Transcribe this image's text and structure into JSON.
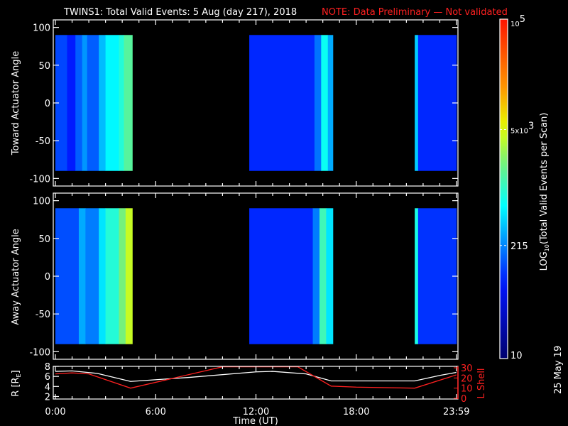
{
  "title": "TWINS1: Total Valid Events:  5 Aug (day 217), 2018",
  "note": "NOTE: Data Preliminary — Not validated",
  "stamp": "25 May 19",
  "colors": {
    "note": "#ff2020",
    "lshell": "#ff2020",
    "rline": "#ffffff",
    "bg": "#000000"
  },
  "chart_data": [
    {
      "type": "heatmap",
      "name": "toward",
      "ylabel": "Toward Actuator Angle",
      "ylim": [
        -110,
        110
      ],
      "yticks": [
        "100",
        "50",
        "0",
        "-50",
        "-100"
      ],
      "ytick_values": [
        100,
        50,
        0,
        -50,
        -100
      ],
      "data_angle_range": [
        -90,
        90
      ],
      "xlim_hours": [
        0,
        24
      ],
      "columns": [
        {
          "start": 0,
          "end": 0.7,
          "counts": 120
        },
        {
          "start": 0.7,
          "end": 1.2,
          "counts": 80
        },
        {
          "start": 1.2,
          "end": 1.6,
          "counts": 150
        },
        {
          "start": 1.6,
          "end": 1.9,
          "counts": 250
        },
        {
          "start": 1.9,
          "end": 2.6,
          "counts": 150
        },
        {
          "start": 2.6,
          "end": 3.0,
          "counts": 350
        },
        {
          "start": 3.0,
          "end": 3.8,
          "counts": 600
        },
        {
          "start": 3.8,
          "end": 4.1,
          "counts": 900
        },
        {
          "start": 4.1,
          "end": 4.6,
          "counts": 1500
        },
        {
          "start": 11.6,
          "end": 15.5,
          "counts": 90
        },
        {
          "start": 15.5,
          "end": 15.9,
          "counts": 180
        },
        {
          "start": 15.9,
          "end": 16.3,
          "counts": 700
        },
        {
          "start": 16.3,
          "end": 16.6,
          "counts": 300
        },
        {
          "start": 21.5,
          "end": 21.7,
          "counts": 400
        },
        {
          "start": 21.7,
          "end": 23.99,
          "counts": 90
        }
      ]
    },
    {
      "type": "heatmap",
      "name": "away",
      "ylabel": "Away Actuator Angle",
      "ylim": [
        -110,
        110
      ],
      "yticks": [
        "100",
        "50",
        "0",
        "-50",
        "-100"
      ],
      "ytick_values": [
        100,
        50,
        0,
        -50,
        -100
      ],
      "data_angle_range": [
        -90,
        90
      ],
      "xlim_hours": [
        0,
        24
      ],
      "columns": [
        {
          "start": 0,
          "end": 1.4,
          "counts": 130
        },
        {
          "start": 1.4,
          "end": 1.8,
          "counts": 300
        },
        {
          "start": 1.8,
          "end": 2.6,
          "counts": 200
        },
        {
          "start": 2.6,
          "end": 3.0,
          "counts": 500
        },
        {
          "start": 3.0,
          "end": 3.8,
          "counts": 900
        },
        {
          "start": 3.8,
          "end": 4.2,
          "counts": 2000
        },
        {
          "start": 4.2,
          "end": 4.6,
          "counts": 4000
        },
        {
          "start": 11.6,
          "end": 15.4,
          "counts": 90
        },
        {
          "start": 15.4,
          "end": 15.8,
          "counts": 200
        },
        {
          "start": 15.8,
          "end": 16.2,
          "counts": 1200
        },
        {
          "start": 16.2,
          "end": 16.6,
          "counts": 500
        },
        {
          "start": 21.5,
          "end": 21.7,
          "counts": 800
        },
        {
          "start": 21.7,
          "end": 23.99,
          "counts": 100
        }
      ]
    },
    {
      "type": "line",
      "name": "orbit",
      "xlabel": "Time (UT)",
      "xticks": [
        "0:00",
        "6:00",
        "12:00",
        "18:00",
        "23:59"
      ],
      "xtick_values": [
        0,
        6,
        12,
        18,
        23.99
      ],
      "ylabel": "R [R",
      "ylabel_sub": "E",
      "ylabel_end": "]",
      "ylim": [
        1.5,
        8
      ],
      "yticks": [
        "8",
        "6",
        "4",
        "2"
      ],
      "ytick_values": [
        8,
        6,
        4,
        2
      ],
      "y2label": "L Shell",
      "y2lim": [
        0,
        30
      ],
      "y2ticks": [
        "30",
        "20",
        "10",
        "0"
      ],
      "y2tick_values": [
        30,
        20,
        10,
        0
      ],
      "series": [
        {
          "name": "R",
          "x": [
            0,
            1,
            2.5,
            4.5,
            8,
            12,
            13,
            15,
            16.5,
            21.5,
            23,
            23.99
          ],
          "y": [
            7,
            7.1,
            6.6,
            5,
            5.8,
            6.9,
            7,
            6.5,
            5.1,
            5.1,
            6.2,
            6.8
          ]
        },
        {
          "name": "L Shell",
          "x": [
            0,
            1,
            2,
            4.5,
            10,
            14.5,
            16.5,
            18,
            21.5,
            23.99
          ],
          "y": [
            24,
            25,
            24,
            10,
            31,
            31,
            12,
            11,
            10,
            23
          ]
        }
      ]
    }
  ],
  "colorbar": {
    "label": "LOG",
    "label_sub": "10",
    "label_end": "(Total Valid Events per Scan)",
    "ticks": [
      {
        "label": "10",
        "value": 10
      },
      {
        "label": "215",
        "value": 215
      },
      {
        "label": "5x10",
        "sup": "3",
        "value": 5000
      },
      {
        "label": "10",
        "sup": "5",
        "value": 100000
      }
    ],
    "range": [
      10,
      100000
    ]
  }
}
